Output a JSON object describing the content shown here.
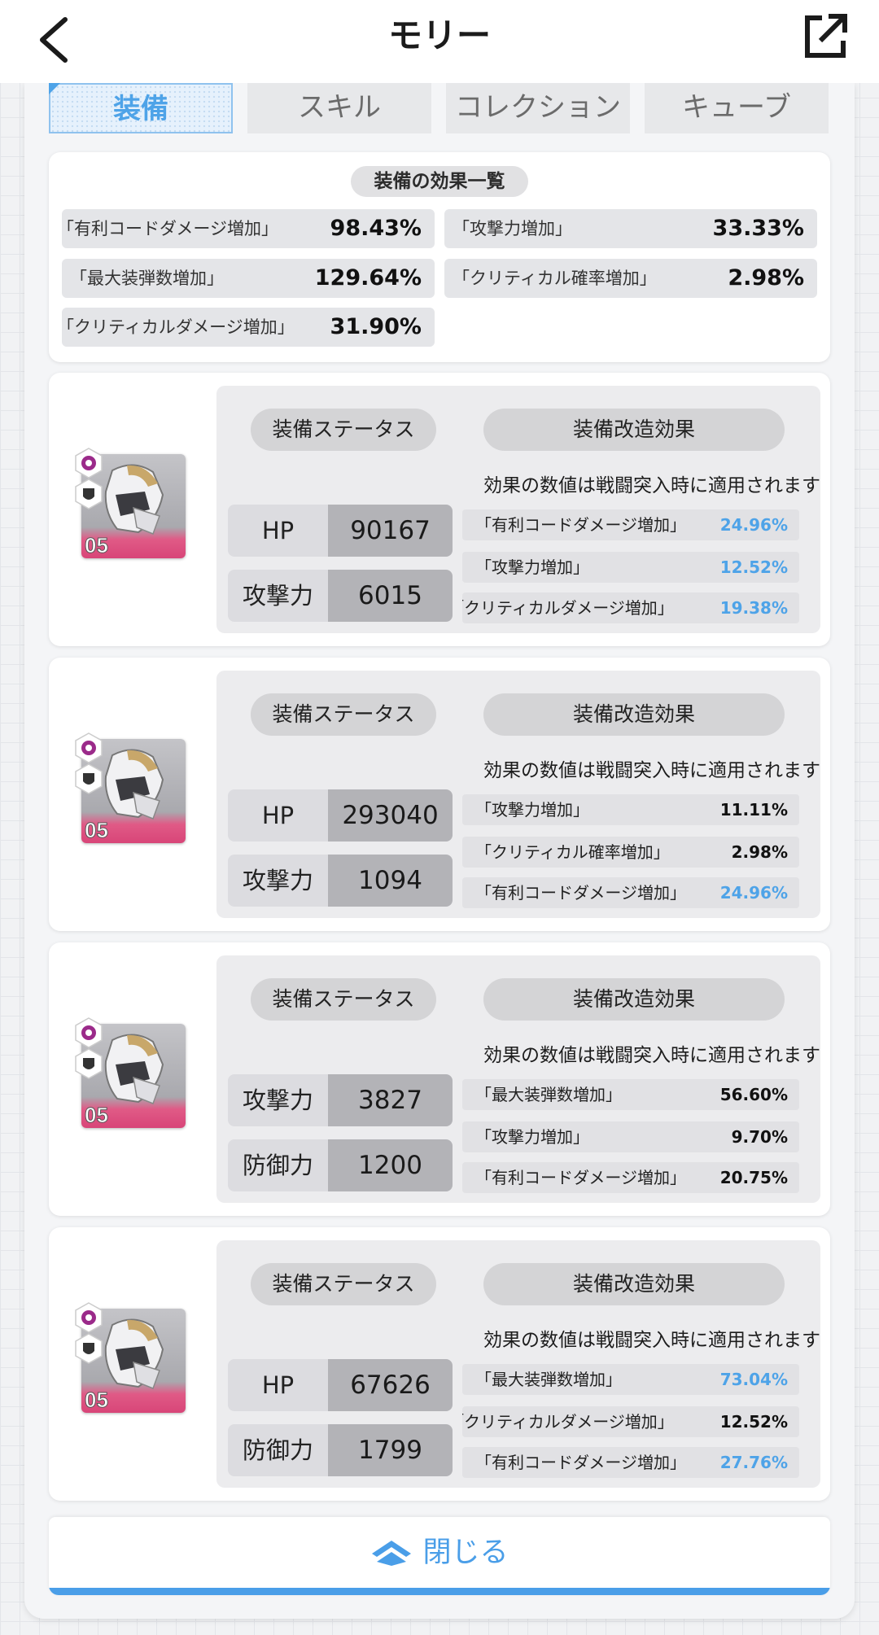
{
  "header": {
    "title": "モリー"
  },
  "tabs": [
    {
      "label": "装備",
      "active": true
    },
    {
      "label": "スキル",
      "active": false
    },
    {
      "label": "コレクション",
      "active": false
    },
    {
      "label": "キューブ",
      "active": false
    }
  ],
  "summary": {
    "title": "装備の効果一覧",
    "items": [
      {
        "label": "「有利コードダメージ増加」",
        "value": "98.43%"
      },
      {
        "label": "「攻撃力増加」",
        "value": "33.33%"
      },
      {
        "label": "「最大装弾数増加」",
        "value": "129.64%"
      },
      {
        "label": "「クリティカル確率増加」",
        "value": "2.98%"
      },
      {
        "label": "「クリティカルダメージ増加」",
        "value": "31.90%"
      }
    ]
  },
  "equipment": [
    {
      "level": "05",
      "status_title": "装備ステータス",
      "mod_title": "装備改造効果",
      "note": "効果の数値は戦闘突入時に適用されます",
      "stats": [
        {
          "label": "HP",
          "value": "90167"
        },
        {
          "label": "攻撃力",
          "value": "6015"
        }
      ],
      "mods": [
        {
          "label": "「有利コードダメージ増加」",
          "value": "24.96%",
          "color": "#4ea3e8"
        },
        {
          "label": "「攻撃力増加」",
          "value": "12.52%",
          "color": "#4ea3e8"
        },
        {
          "label": "「クリティカルダメージ増加」",
          "value": "19.38%",
          "color": "#4ea3e8"
        }
      ]
    },
    {
      "level": "05",
      "status_title": "装備ステータス",
      "mod_title": "装備改造効果",
      "note": "効果の数値は戦闘突入時に適用されます",
      "stats": [
        {
          "label": "HP",
          "value": "293040"
        },
        {
          "label": "攻撃力",
          "value": "1094"
        }
      ],
      "mods": [
        {
          "label": "「攻撃力増加」",
          "value": "11.11%",
          "color": "#111111"
        },
        {
          "label": "「クリティカル確率増加」",
          "value": "2.98%",
          "color": "#111111"
        },
        {
          "label": "「有利コードダメージ増加」",
          "value": "24.96%",
          "color": "#4ea3e8"
        }
      ]
    },
    {
      "level": "05",
      "status_title": "装備ステータス",
      "mod_title": "装備改造効果",
      "note": "効果の数値は戦闘突入時に適用されます",
      "stats": [
        {
          "label": "攻撃力",
          "value": "3827"
        },
        {
          "label": "防御力",
          "value": "1200"
        }
      ],
      "mods": [
        {
          "label": "「最大装弾数増加」",
          "value": "56.60%",
          "color": "#111111"
        },
        {
          "label": "「攻撃力増加」",
          "value": "9.70%",
          "color": "#111111"
        },
        {
          "label": "「有利コードダメージ増加」",
          "value": "20.75%",
          "color": "#111111"
        }
      ]
    },
    {
      "level": "05",
      "status_title": "装備ステータス",
      "mod_title": "装備改造効果",
      "note": "効果の数値は戦闘突入時に適用されます",
      "stats": [
        {
          "label": "HP",
          "value": "67626"
        },
        {
          "label": "防御力",
          "value": "1799"
        }
      ],
      "mods": [
        {
          "label": "「最大装弾数増加」",
          "value": "73.04%",
          "color": "#4ea3e8"
        },
        {
          "label": "「クリティカルダメージ増加」",
          "value": "12.52%",
          "color": "#111111"
        },
        {
          "label": "「有利コードダメージ増加」",
          "value": "27.76%",
          "color": "#4ea3e8"
        }
      ]
    }
  ],
  "close_button": {
    "label": "閉じる"
  },
  "colors": {
    "accent": "#4a9ee8",
    "tab_active_bg": "#e6f1fc",
    "stat_value_bg": "#b3b3b7",
    "level_bar": "#d84578"
  },
  "icons": {
    "back": "chevron-left-icon",
    "share": "external-link-icon",
    "close": "double-chevron-up-icon"
  }
}
